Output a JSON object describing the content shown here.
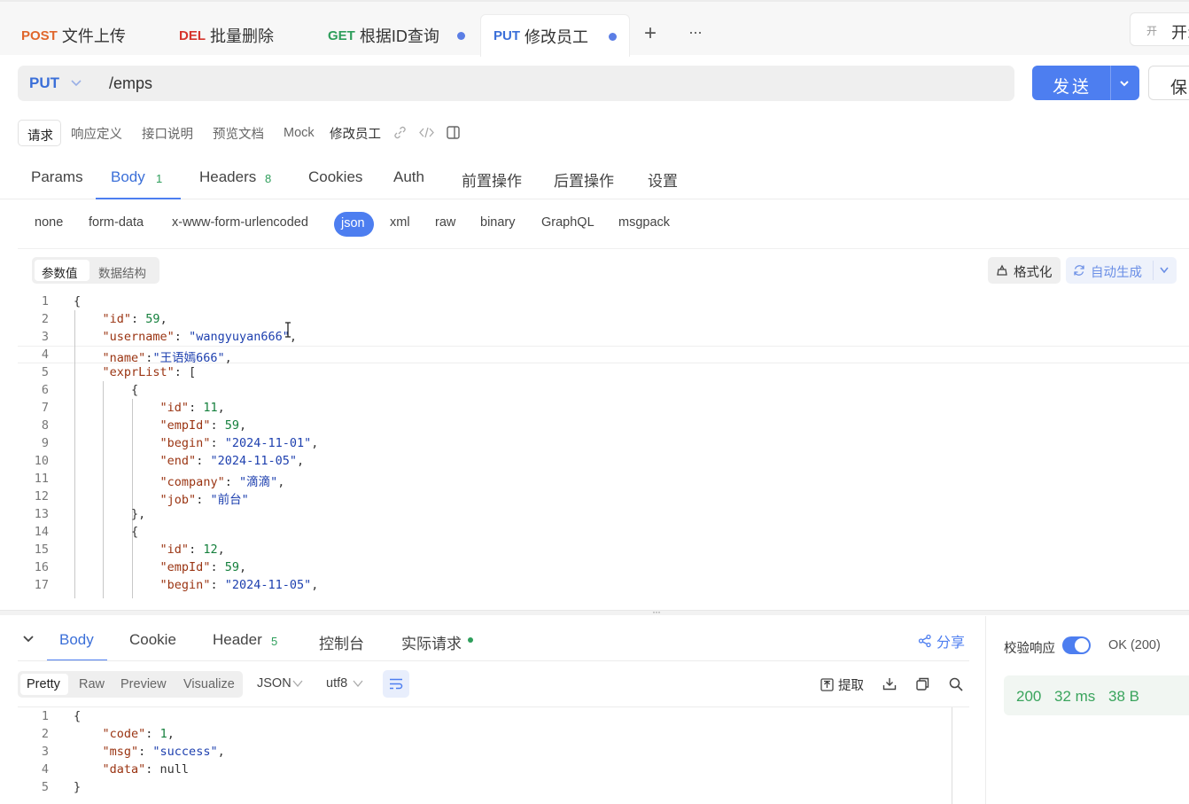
{
  "tabs": [
    {
      "method": "POST",
      "title": "文件上传"
    },
    {
      "method": "DEL",
      "title": "批量删除"
    },
    {
      "method": "GET",
      "title": "根据ID查询"
    },
    {
      "method": "PUT",
      "title": "修改员工"
    }
  ],
  "tab_actions": {
    "add": "+",
    "more": "···",
    "toggle_label": "开",
    "toggle_text": "开:"
  },
  "request": {
    "method": "PUT",
    "url": "/emps",
    "send_label": "发送",
    "save_label": "保"
  },
  "segments": [
    "请求",
    "响应定义",
    "接口说明",
    "预览文档",
    "Mock"
  ],
  "api_name": "修改员工",
  "subtabs": [
    {
      "label": "Params",
      "count": ""
    },
    {
      "label": "Body",
      "count": "1"
    },
    {
      "label": "Headers",
      "count": "8"
    },
    {
      "label": "Cookies",
      "count": ""
    },
    {
      "label": "Auth",
      "count": ""
    },
    {
      "label": "前置操作",
      "count": ""
    },
    {
      "label": "后置操作",
      "count": ""
    },
    {
      "label": "设置",
      "count": ""
    }
  ],
  "body_types": [
    "none",
    "form-data",
    "x-www-form-urlencoded",
    "json",
    "xml",
    "raw",
    "binary",
    "GraphQL",
    "msgpack"
  ],
  "body_mode": {
    "value_tab": "参数值",
    "schema_tab": "数据结构",
    "format_label": "格式化",
    "autogen_label": "自动生成"
  },
  "request_body_lines": [
    "{",
    "    \"id\": 59,",
    "    \"username\": \"wangyuyan666\",",
    "    \"name\":\"王语嫣666\",",
    "    \"exprList\": [",
    "        {",
    "            \"id\": 11,",
    "            \"empId\": 59,",
    "            \"begin\": \"2024-11-01\",",
    "            \"end\": \"2024-11-05\",",
    "            \"company\": \"滴滴\",",
    "            \"job\": \"前台\"",
    "        },",
    "        {",
    "            \"id\": 12,",
    "            \"empId\": 59,",
    "            \"begin\": \"2024-11-05\","
  ],
  "response": {
    "tabs": [
      {
        "label": "Body",
        "count": ""
      },
      {
        "label": "Cookie",
        "count": ""
      },
      {
        "label": "Header",
        "count": "5"
      },
      {
        "label": "控制台",
        "count": ""
      },
      {
        "label": "实际请求",
        "count": ""
      }
    ],
    "share_label": "分享",
    "views": [
      "Pretty",
      "Raw",
      "Preview",
      "Visualize"
    ],
    "format": "JSON",
    "encoding": "utf8",
    "extract_label": "提取",
    "validate_label": "校验响应",
    "status_text": "OK (200)",
    "status_code": "200",
    "time": "32 ms",
    "size": "38 B",
    "body_lines": [
      "{",
      "    \"code\": 1,",
      "    \"msg\": \"success\",",
      "    \"data\": null",
      "}"
    ]
  },
  "colors": {
    "accent": "#4d7ef0",
    "post": "#e0662b",
    "del": "#d6342c",
    "get": "#2e9e5b",
    "put": "#3b6fd8",
    "status_ok": "#2e9e5b"
  }
}
